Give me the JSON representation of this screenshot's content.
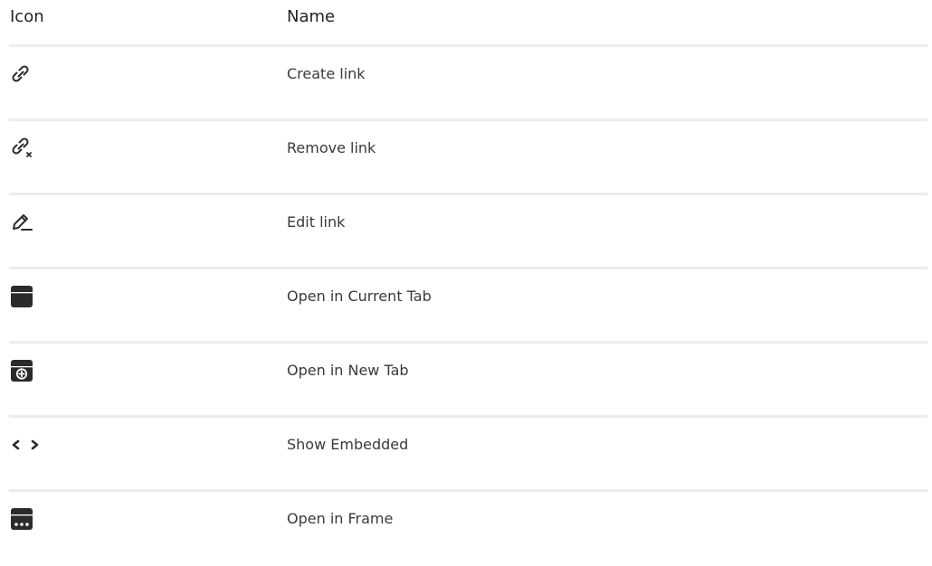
{
  "table": {
    "headers": {
      "icon": "Icon",
      "name": "Name"
    },
    "rows": [
      {
        "icon": "link-icon",
        "name": "Create link"
      },
      {
        "icon": "unlink-icon",
        "name": "Remove link"
      },
      {
        "icon": "pencil-underline-icon",
        "name": "Edit link"
      },
      {
        "icon": "window-icon",
        "name": "Open in Current Tab"
      },
      {
        "icon": "window-plus-icon",
        "name": "Open in New Tab"
      },
      {
        "icon": "code-brackets-icon",
        "name": "Show Embedded"
      },
      {
        "icon": "window-dots-icon",
        "name": "Open in Frame"
      }
    ]
  },
  "colors": {
    "text": "#3a3a3a",
    "divider": "#ececec",
    "icon": "#2b2b2b"
  }
}
